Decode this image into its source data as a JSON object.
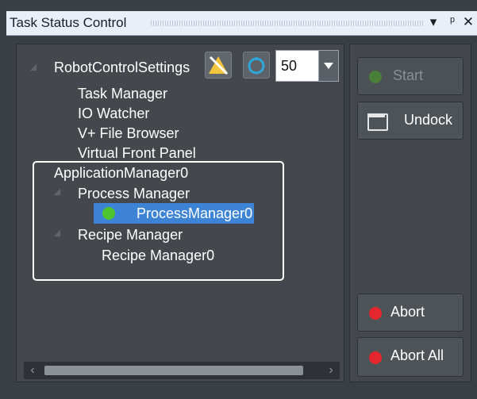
{
  "window": {
    "title": "Task Status Control",
    "pin_icon": "pin-icon",
    "close_icon": "close-icon",
    "menu_icon": "dropdown-icon"
  },
  "tree": {
    "root": "RobotControlSettings",
    "root_children": [
      "Task Manager",
      "IO Watcher",
      "V+ File Browser",
      "Virtual Front Panel"
    ],
    "app_manager": "ApplicationManager0",
    "process_manager": "Process Manager",
    "process_manager_item": "ProcessManager0",
    "recipe_manager": "Recipe Manager",
    "recipe_manager_item": "Recipe Manager0"
  },
  "toolbar": {
    "monitor_speed_value": "50"
  },
  "buttons": {
    "start": "Start",
    "undock": "Undock",
    "abort": "Abort",
    "abort_all": "Abort All"
  },
  "colors": {
    "green_status": "#4ec42f",
    "red_status": "#e5262c",
    "selection": "#3e84d6"
  }
}
